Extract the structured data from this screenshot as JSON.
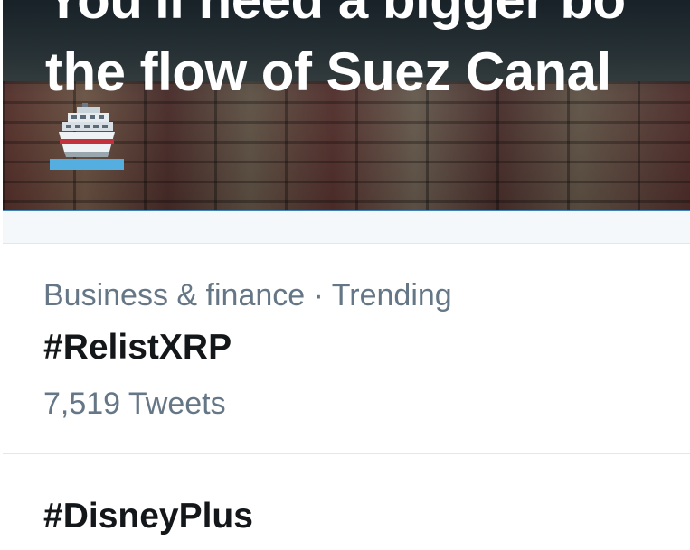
{
  "hero": {
    "headline": "You'll need a bigger bo\nthe flow of Suez Canal",
    "emoji": "ship-icon"
  },
  "trends": [
    {
      "category": "Business & finance · Trending",
      "name": "#RelistXRP",
      "count": "7,519 Tweets"
    },
    {
      "name": "#DisneyPlus"
    }
  ],
  "colors": {
    "meta_text": "#657786",
    "primary_text": "#14171a",
    "divider": "#e1e8ed",
    "band": "#f5f8fa"
  }
}
